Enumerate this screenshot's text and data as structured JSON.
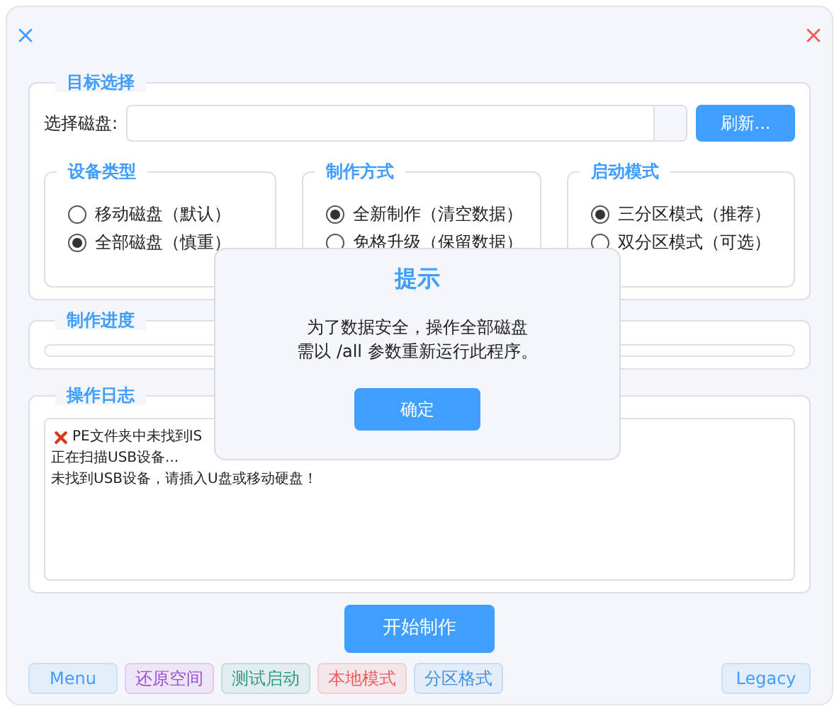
{
  "target": {
    "legend": "目标选择",
    "disk_label": "选择磁盘:",
    "refresh_button": "刷新..."
  },
  "options": [
    {
      "legend": "设备类型",
      "items": [
        {
          "label": "移动磁盘（默认）",
          "selected": false
        },
        {
          "label": "全部磁盘（慎重）",
          "selected": true
        }
      ]
    },
    {
      "legend": "制作方式",
      "items": [
        {
          "label": "全新制作（清空数据）",
          "selected": true
        },
        {
          "label": "免格升级（保留数据）",
          "selected": false
        }
      ]
    },
    {
      "legend": "启动模式",
      "items": [
        {
          "label": "三分区模式（推荐）",
          "selected": true
        },
        {
          "label": "双分区模式（可选）",
          "selected": false
        }
      ]
    }
  ],
  "progress": {
    "legend": "制作进度",
    "level": 0
  },
  "log": {
    "legend": "操作日志",
    "lines": [
      {
        "kind": "error",
        "text": "PE文件夹中未找到IS"
      },
      {
        "kind": "info",
        "text": "正在扫描USB设备..."
      },
      {
        "kind": "info",
        "text": "未找到USB设备，请插入U盘或移动硬盘！"
      }
    ]
  },
  "start_button": "开始制作",
  "footer_buttons": [
    {
      "label": "Menu",
      "color": "#409eff"
    },
    {
      "label": "还原空间",
      "color": "#9b4fd6"
    },
    {
      "label": "测试启动",
      "color": "#2e9c86"
    },
    {
      "label": "本地模式",
      "color": "#f05a5a"
    },
    {
      "label": "分区格式",
      "color": "#3d8fe8"
    }
  ],
  "side_button": {
    "label": "Legacy",
    "color": "#409eff"
  },
  "dialog": {
    "title": "提示",
    "message_lines": [
      "为了数据安全，操作全部磁盘",
      "需以 /all 参数重新运行此程序。"
    ],
    "button": "确定"
  }
}
